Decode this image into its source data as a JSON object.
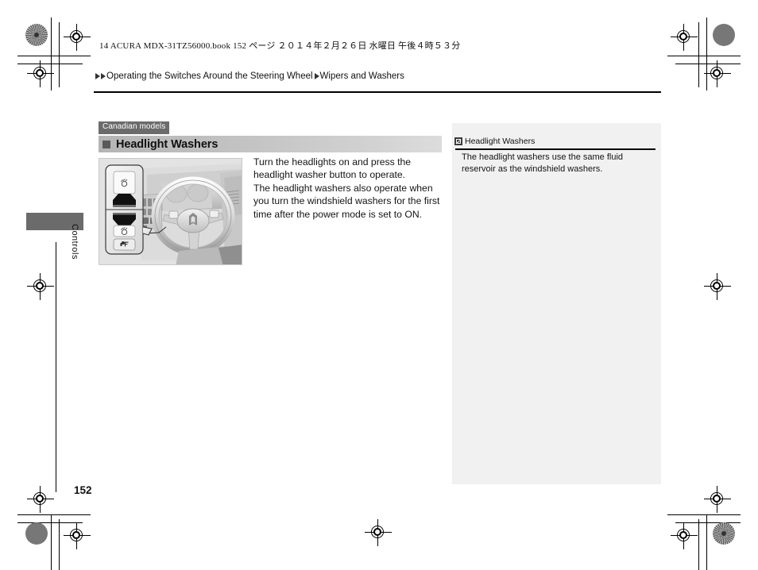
{
  "print_slug": "14 ACURA MDX-31TZ56000.book   152 ページ   ２０１４年２月２６日   水曜日   午後４時５３分",
  "breadcrumb": {
    "crumb1": "Operating the Switches Around the Steering Wheel",
    "crumb2": "Wipers and Washers"
  },
  "side_tab": {
    "label": "Controls"
  },
  "content": {
    "model_badge": "Canadian models",
    "section_title": "Headlight Washers",
    "body_paragraphs": [
      "Turn the headlights on and press the headlight washer button to operate.",
      "The headlight washers also operate when you turn the windshield washers for the first time after the power mode is set to ON."
    ]
  },
  "info_panel": {
    "heading": "Headlight Washers",
    "body": "The headlight washers use the same fluid reservoir as the windshield washers."
  },
  "page_number": "152",
  "colors": {
    "badge_gray": "#6b6b6b",
    "section_bar_gray": "#c4c4c4",
    "panel_gray": "#f1f1f1",
    "illustration_gray": "#e3e3e3",
    "rule_black": "#000000"
  }
}
